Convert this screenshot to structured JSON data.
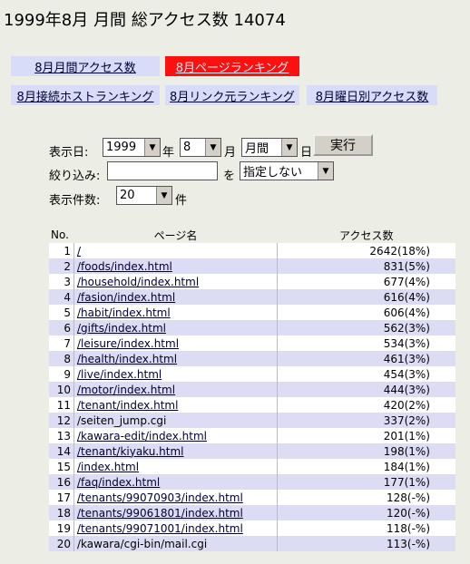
{
  "header": {
    "title": "1999年8月 月間 総アクセス数 14074"
  },
  "tabs": [
    {
      "label": "8月月間アクセス数"
    },
    {
      "label": "8月ページランキング"
    },
    {
      "label": "8月接続ホストランキング"
    },
    {
      "label": "8月リンク元ランキング"
    },
    {
      "label": "8月曜日別アクセス数"
    }
  ],
  "form": {
    "date_label": "表示日:",
    "year_value": "1999",
    "year_unit": "年",
    "month_value": "8",
    "month_unit": "月",
    "period_value": "月間",
    "day_unit": "日",
    "submit_label": "実行",
    "filter_label": "絞り込み:",
    "filter_value": "",
    "filter_connector": "を",
    "filter_mode": "指定しない",
    "count_label": "表示件数:",
    "count_value": "20",
    "count_unit": "件"
  },
  "table": {
    "headers": {
      "no": "No.",
      "page": "ページ名",
      "count": "アクセス数"
    },
    "rows": [
      {
        "no": "1",
        "page": "/",
        "link": true,
        "count": "2642(18%)"
      },
      {
        "no": "2",
        "page": "/foods/index.html",
        "link": true,
        "count": "831(5%)"
      },
      {
        "no": "3",
        "page": "/household/index.html",
        "link": true,
        "count": "677(4%)"
      },
      {
        "no": "4",
        "page": "/fasion/index.html",
        "link": true,
        "count": "616(4%)"
      },
      {
        "no": "5",
        "page": "/habit/index.html",
        "link": true,
        "count": "606(4%)"
      },
      {
        "no": "6",
        "page": "/gifts/index.html",
        "link": true,
        "count": "562(3%)"
      },
      {
        "no": "7",
        "page": "/leisure/index.html",
        "link": true,
        "count": "534(3%)"
      },
      {
        "no": "8",
        "page": "/health/index.html",
        "link": true,
        "count": "461(3%)"
      },
      {
        "no": "9",
        "page": "/live/index.html",
        "link": true,
        "count": "454(3%)"
      },
      {
        "no": "10",
        "page": "/motor/index.html",
        "link": true,
        "count": "444(3%)"
      },
      {
        "no": "11",
        "page": "/tenant/index.html",
        "link": true,
        "count": "420(2%)"
      },
      {
        "no": "12",
        "page": "/seiten_jump.cgi",
        "link": false,
        "count": "337(2%)"
      },
      {
        "no": "13",
        "page": "/kawara-edit/index.html",
        "link": true,
        "count": "201(1%)"
      },
      {
        "no": "14",
        "page": "/tenant/kiyaku.html",
        "link": true,
        "count": "198(1%)"
      },
      {
        "no": "15",
        "page": "/index.html",
        "link": true,
        "count": "184(1%)"
      },
      {
        "no": "16",
        "page": "/faq/index.html",
        "link": true,
        "count": "177(1%)"
      },
      {
        "no": "17",
        "page": "/tenants/99070903/index.html",
        "link": true,
        "count": "128(-%)"
      },
      {
        "no": "18",
        "page": "/tenants/99061801/index.html",
        "link": true,
        "count": "120(-%)"
      },
      {
        "no": "19",
        "page": "/tenants/99071001/index.html",
        "link": true,
        "count": "118(-%)"
      },
      {
        "no": "20",
        "page": "/kawara/cgi-bin/mail.cgi",
        "link": false,
        "count": "113(-%)"
      }
    ]
  }
}
